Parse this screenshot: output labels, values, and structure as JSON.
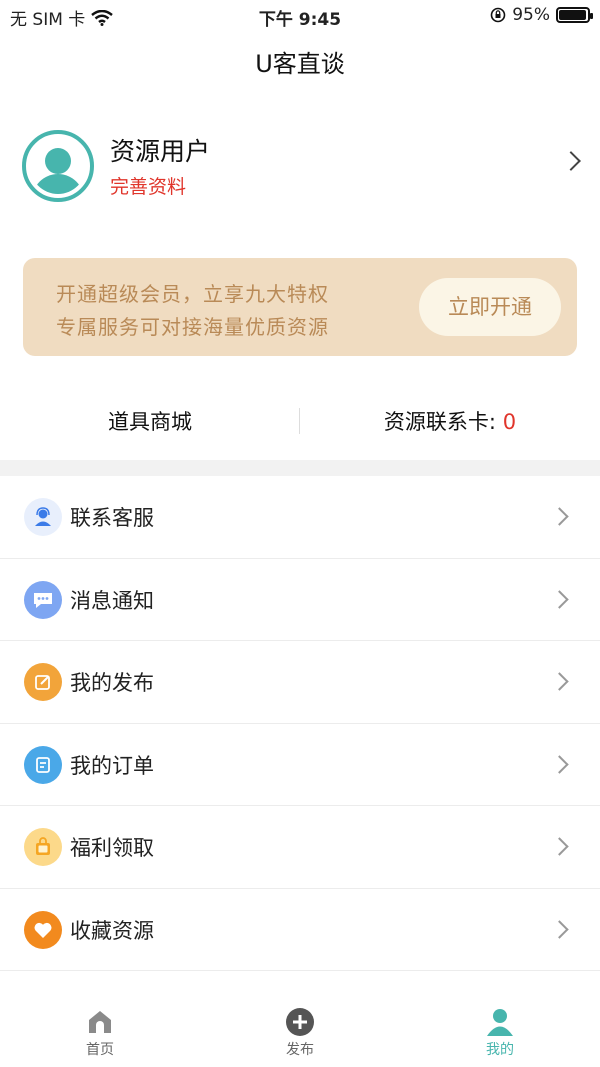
{
  "status_bar": {
    "carrier": "无 SIM 卡",
    "time": "下午 9:45",
    "battery": "95%",
    "battery_level": 0.95
  },
  "nav": {
    "title": "U客直谈"
  },
  "profile": {
    "name": "资源用户",
    "link": "完善资料",
    "avatar_color": "#47b5ad"
  },
  "vip_banner": {
    "line1": "开通超级会员，立享九大特权",
    "line2": "专属服务可对接海量优质资源",
    "button": "立即开通"
  },
  "shop": {
    "props_store": "道具商城",
    "contact_card_label": "资源联系卡: ",
    "contact_card_count": "0"
  },
  "menu": [
    {
      "label": "联系客服",
      "icon": "customer-service-icon",
      "color": "#3b7be8"
    },
    {
      "label": "消息通知",
      "icon": "message-icon",
      "color": "#5b8ff0"
    },
    {
      "label": "我的发布",
      "icon": "edit-icon",
      "color": "#f2a43a"
    },
    {
      "label": "我的订单",
      "icon": "order-icon",
      "color": "#4aa8e8"
    },
    {
      "label": "福利领取",
      "icon": "gift-bag-icon",
      "color": "#f5b731"
    },
    {
      "label": "收藏资源",
      "icon": "heart-icon",
      "color": "#f28a1e"
    }
  ],
  "tabs": [
    {
      "label": "首页",
      "icon": "home-icon"
    },
    {
      "label": "发布",
      "icon": "plus-icon"
    },
    {
      "label": "我的",
      "icon": "profile-icon",
      "active": true
    }
  ],
  "colors": {
    "accent": "#47b5ad",
    "red": "#e0352b",
    "vip_bg": "#f0dcc1",
    "vip_text": "#b98a57"
  }
}
